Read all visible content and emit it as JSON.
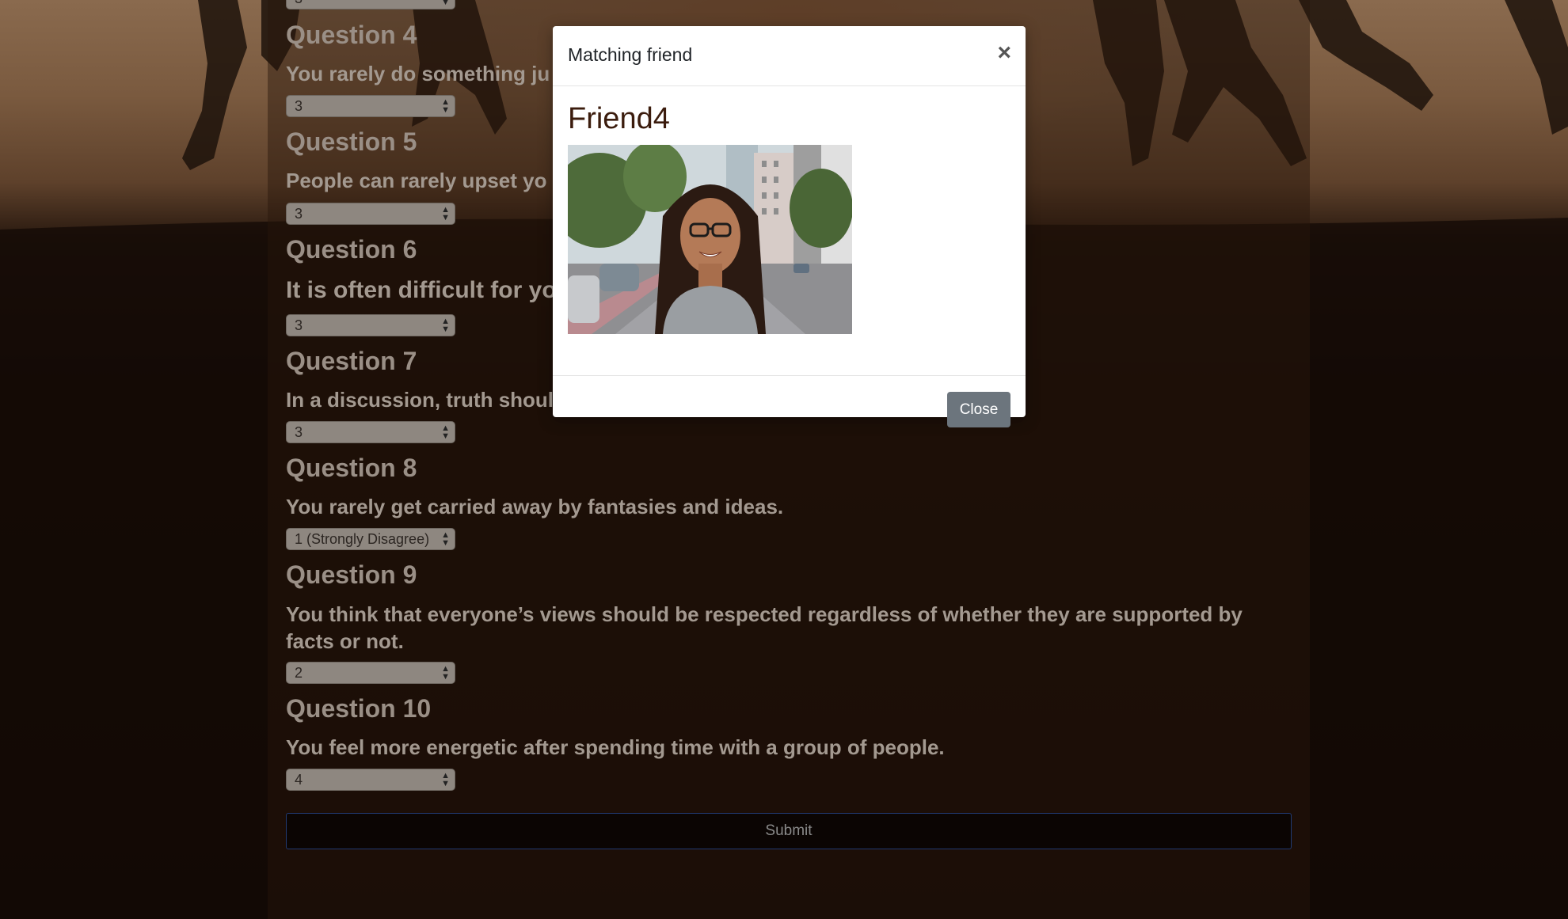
{
  "questions": [
    {
      "title": "Question 4",
      "text": "You rarely do something ju",
      "value": "3"
    },
    {
      "title": "Question 5",
      "text": "People can rarely upset yo",
      "value": "3"
    },
    {
      "title": "Question 6",
      "text": "It is often difficult for yo",
      "value": "3"
    },
    {
      "title": "Question 7",
      "text": "In a discussion, truth shoul",
      "value": "3"
    },
    {
      "title": "Question 8",
      "text": "You rarely get carried away by fantasies and ideas.",
      "value": "1 (Strongly Disagree)"
    },
    {
      "title": "Question 9",
      "text": "You think that everyone’s views should be respected regardless of whether they are supported by facts or not.",
      "value": "2"
    },
    {
      "title": "Question 10",
      "text": "You feel more energetic after spending time with a group of people.",
      "value": "4"
    }
  ],
  "partial_top_select_value": "3",
  "submit_label": "Submit",
  "modal": {
    "title": "Matching friend",
    "close_symbol": "×",
    "friend_name": "Friend4",
    "close_button_label": "Close"
  },
  "colors": {
    "modal_button": "#6c757d",
    "friend_name": "#3b1c0d",
    "submit_border": "#213a72"
  }
}
